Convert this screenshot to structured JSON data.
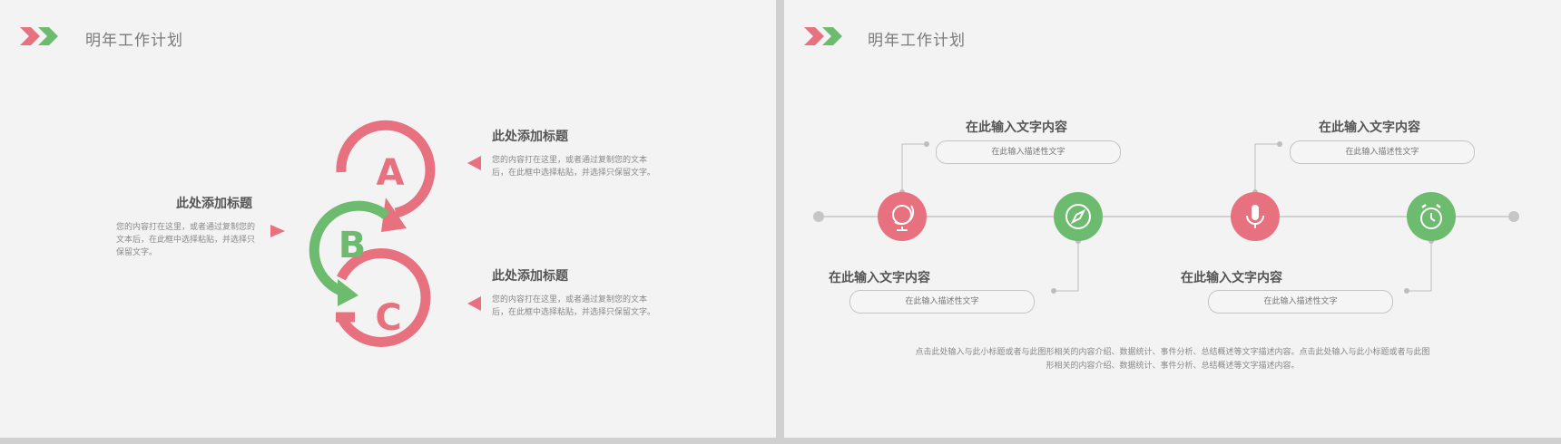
{
  "colors": {
    "pink": "#e8717f",
    "green": "#6dbb6e",
    "line": "#bdbdbd",
    "slide_bg": "#f3f3f3"
  },
  "slide1": {
    "header_title": "明年工作计划",
    "letters": [
      "A",
      "B",
      "C"
    ],
    "left_block": {
      "title": "此处添加标题",
      "text": "您的内容打在这里，或者通过复制您的文本后，在此框中选择粘贴，并选择只保留文字。"
    },
    "right_top": {
      "title": "此处添加标题",
      "text_line1": "您的内容打在这里，或者通过复制您的文本",
      "text_line2": "后，在此框中选择粘贴，并选择只保留文字。"
    },
    "right_bottom": {
      "title": "此处添加标题",
      "text_line1": "您的内容打在这里，或者通过复制您的文本",
      "text_line2": "后，在此框中选择粘贴，并选择只保留文字。"
    }
  },
  "slide2": {
    "header_title": "明年工作计划",
    "items": [
      {
        "title": "在此输入文字内容",
        "desc": "在此输入描述性文字",
        "icon": "globe-icon",
        "color": "pink"
      },
      {
        "title": "在此输入文字内容",
        "desc": "在此输入描述性文字",
        "icon": "compass-icon",
        "color": "green"
      },
      {
        "title": "在此输入文字内容",
        "desc": "在此输入描述性文字",
        "icon": "microphone-icon",
        "color": "pink"
      },
      {
        "title": "在此输入文字内容",
        "desc": "在此输入描述性文字",
        "icon": "alarm-clock-icon",
        "color": "green"
      }
    ],
    "footer_line1": "点击此处输入与此小标题或者与此图形相关的内容介绍、数据统计、事件分析、总结概述等文字描述内容。点击此处输入与此小标题或者与此图",
    "footer_line2": "形相关的内容介绍、数据统计、事件分析、总结概述等文字描述内容。"
  }
}
